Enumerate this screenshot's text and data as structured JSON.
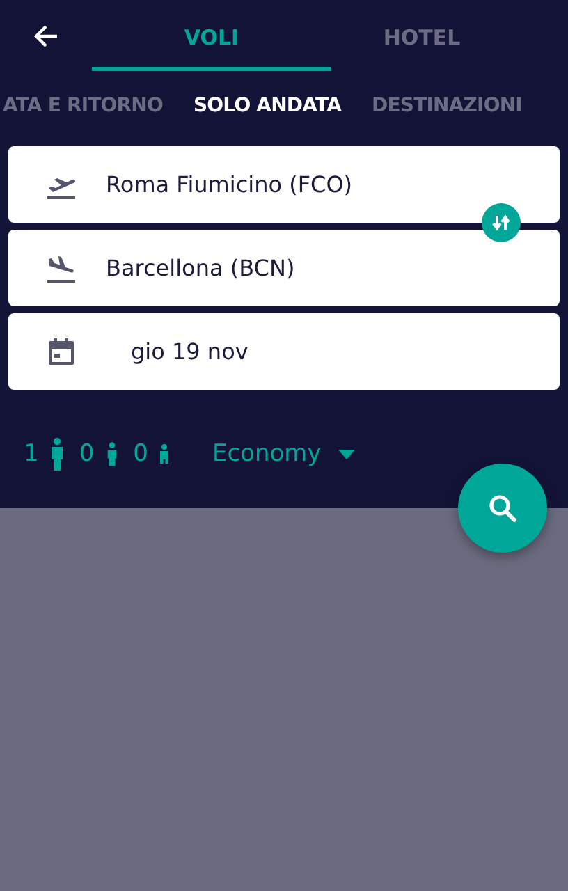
{
  "tabs": [
    {
      "label": "VOLI",
      "selected": true
    },
    {
      "label": "HOTEL",
      "selected": false
    }
  ],
  "trip_types": [
    {
      "label": "ATA E RITORNO",
      "selected": false
    },
    {
      "label": "SOLO ANDATA",
      "selected": true
    },
    {
      "label": "DESTINAZIONI",
      "selected": false
    }
  ],
  "fields": [
    {
      "kind": "departure",
      "value": "Roma Fiumicino (FCO)"
    },
    {
      "kind": "arrival",
      "value": "Barcellona (BCN)"
    },
    {
      "kind": "date",
      "value": "gio 19 nov"
    }
  ],
  "passengers": [
    {
      "kind": "adult",
      "count": "1"
    },
    {
      "kind": "child",
      "count": "0"
    },
    {
      "kind": "infant",
      "count": "0"
    }
  ],
  "cabin_class": "Economy"
}
